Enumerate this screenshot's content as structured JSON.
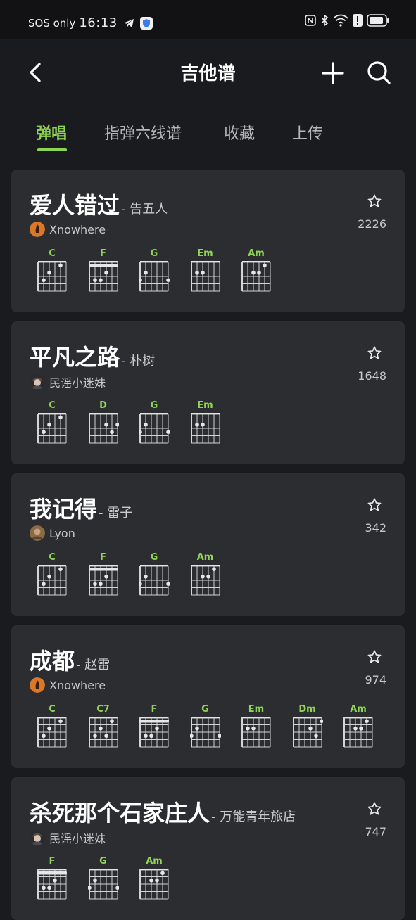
{
  "status": {
    "network": "SOS only",
    "time": "16:13"
  },
  "header": {
    "title": "吉他谱"
  },
  "tabs": [
    {
      "label": "弹唱",
      "active": true
    },
    {
      "label": "指弹六线谱",
      "active": false
    },
    {
      "label": "收藏",
      "active": false
    },
    {
      "label": "上传",
      "active": false
    }
  ],
  "colors": {
    "accent": "#8fd455",
    "card": "#2c2d31",
    "background": "#1a1b1e"
  },
  "songs": [
    {
      "title": "爱人错过",
      "artist": "- 告五人",
      "author": "Xnowhere",
      "avatar": "orange-flame-avatar",
      "stars": "2226",
      "chords": [
        "C",
        "F",
        "G",
        "Em",
        "Am"
      ]
    },
    {
      "title": "平凡之路",
      "artist": "- 朴树",
      "author": "民谣小迷妹",
      "avatar": "anime-avatar",
      "stars": "1648",
      "chords": [
        "C",
        "D",
        "G",
        "Em"
      ]
    },
    {
      "title": "我记得",
      "artist": "- 雷子",
      "author": "Lyon",
      "avatar": "brown-photo-avatar",
      "stars": "342",
      "chords": [
        "C",
        "F",
        "G",
        "Am"
      ]
    },
    {
      "title": "成都",
      "artist": "- 赵雷",
      "author": "Xnowhere",
      "avatar": "orange-flame-avatar",
      "stars": "974",
      "chords": [
        "C",
        "C7",
        "F",
        "G",
        "Em",
        "Dm",
        "Am"
      ]
    },
    {
      "title": "杀死那个石家庄人",
      "artist": "- 万能青年旅店",
      "author": "民谣小迷妹",
      "avatar": "anime-avatar",
      "stars": "747",
      "chords": [
        "F",
        "G",
        "Am"
      ]
    }
  ]
}
